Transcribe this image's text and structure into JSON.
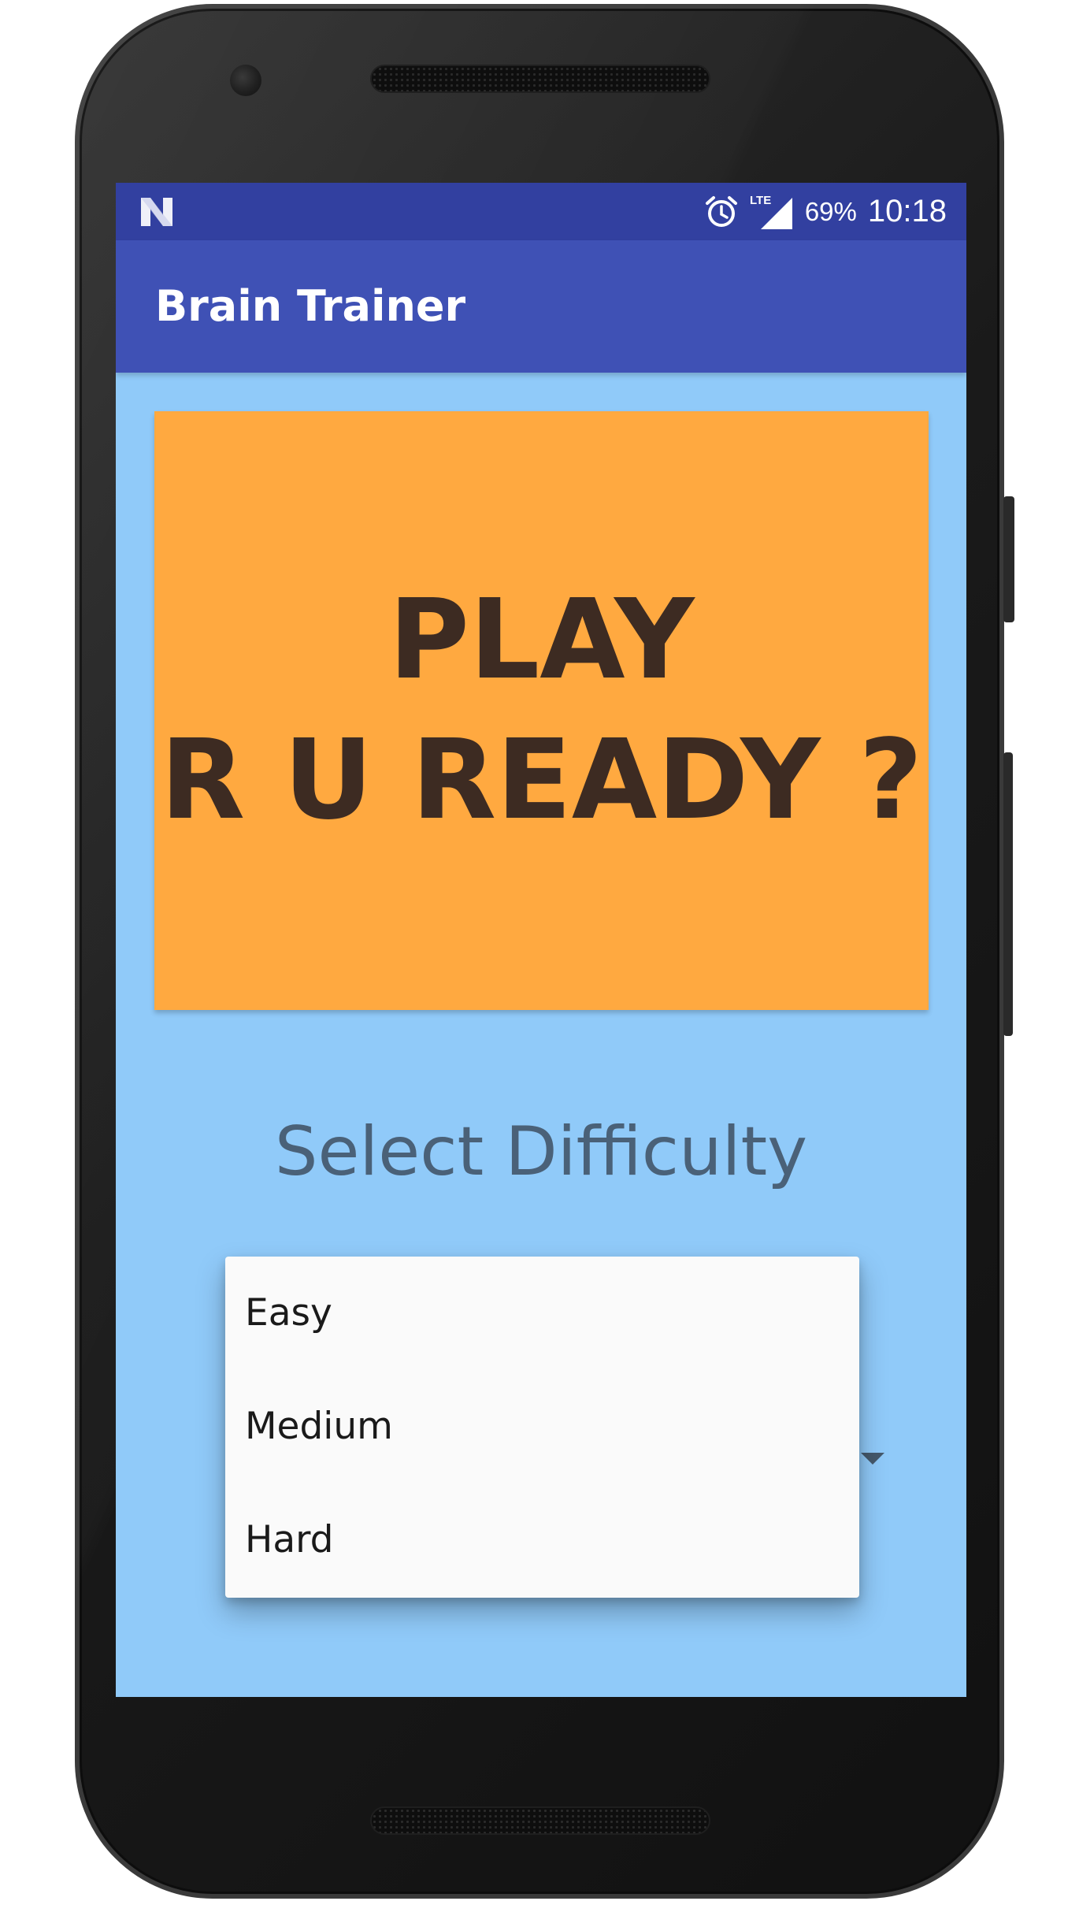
{
  "status_bar": {
    "battery": "69%",
    "time": "10:18",
    "network_label": "LTE",
    "icons": [
      "n-notification-icon",
      "alarm-icon",
      "lte-signal-icon"
    ]
  },
  "app_bar": {
    "title": "Brain Trainer",
    "color": "#3f51b5"
  },
  "play_button": {
    "line1": "PLAY",
    "line2": "R U READY ?",
    "color": "#ffa940"
  },
  "difficulty": {
    "label": "Select Difficulty",
    "options": [
      "Easy",
      "Medium",
      "Hard"
    ]
  },
  "colors": {
    "screen_background": "#90caf9",
    "status_bar": "#3240a0",
    "play_text": "#3d2b22"
  }
}
